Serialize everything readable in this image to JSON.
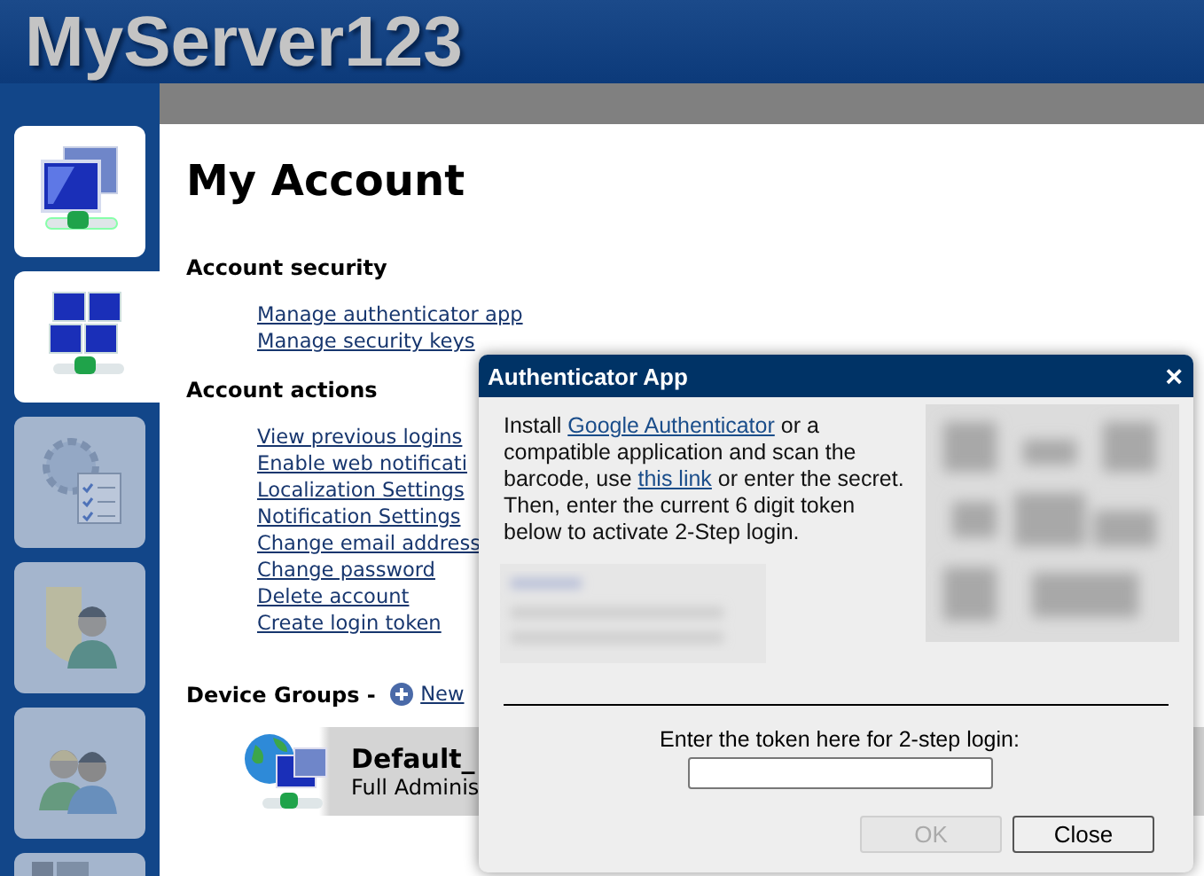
{
  "header": {
    "title": "MyServer123"
  },
  "sidebar": {
    "items": [
      {
        "kind": "monitors",
        "selected": false,
        "disabled": false
      },
      {
        "kind": "grid",
        "selected": true,
        "disabled": false
      },
      {
        "kind": "settings",
        "selected": false,
        "disabled": true
      },
      {
        "kind": "folder-user",
        "selected": false,
        "disabled": true
      },
      {
        "kind": "users",
        "selected": false,
        "disabled": true
      },
      {
        "kind": "device",
        "selected": false,
        "disabled": true
      }
    ]
  },
  "page": {
    "title": "My Account",
    "sections": [
      {
        "heading": "Account security",
        "links": [
          "Manage authenticator app",
          "Manage security keys"
        ]
      },
      {
        "heading": "Account actions",
        "links": [
          "View previous logins",
          "Enable web notificati",
          "Localization Settings",
          "Notification Settings",
          "Change email address",
          "Change password",
          "Delete account",
          "Create login token"
        ]
      }
    ],
    "device_groups": {
      "heading": "Device Groups - ",
      "new_link": "New",
      "groups": [
        {
          "name": "Default_",
          "subtitle": "Full Adminis"
        }
      ]
    }
  },
  "dialog": {
    "title": "Authenticator App",
    "close": "×",
    "intro": [
      {
        "kind": "text",
        "text": "Install "
      },
      {
        "kind": "link",
        "text": "Google Authenticator"
      },
      {
        "kind": "text",
        "text": " or a compatible application and scan the barcode, use "
      },
      {
        "kind": "link",
        "text": "this link"
      },
      {
        "kind": "text",
        "text": " or enter the secret. Then, enter the current 6 digit token below to activate 2-Step login."
      }
    ],
    "token_label": "Enter the token here for 2-step login:",
    "buttons": [
      {
        "label": "OK",
        "disabled": true
      },
      {
        "label": "Close",
        "disabled": false
      }
    ]
  }
}
